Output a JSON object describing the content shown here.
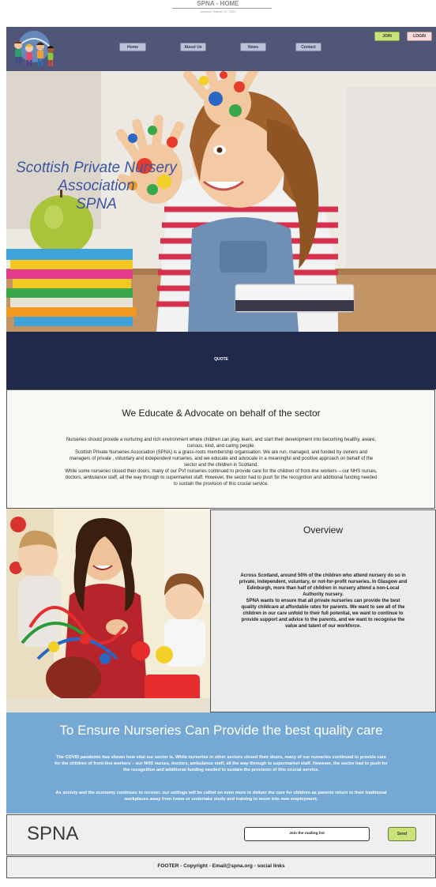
{
  "document": {
    "title": "SPNA - HOME",
    "meta": "seaimoi | March 17, 2022"
  },
  "header": {
    "nav": [
      "Home",
      "About Us",
      "News",
      "Contact"
    ],
    "join_label": "JOIN",
    "login_label": "LOGIN",
    "bg_color": "#4f5677"
  },
  "hero": {
    "title_lines": [
      "Scottish Private Nursery",
      "Association",
      "SPNA"
    ]
  },
  "quote": {
    "text": "QUOTE"
  },
  "educate": {
    "heading": "We Educate & Advocate on behalf of the sector",
    "paragraphs": [
      "Nurseries should provide a nurturing and rich environment where children can play, learn, and start their development into becoming healthy, aware, curious, kind, and caring people.",
      "Scottish Private Nurseries Association (SPNA) is a grass-roots membership organisation. We are run, managed, and funded by owners and managers of private , voluntary and independent nurseries, and we educate and advocate in a meaningful and positive approach on behalf of the sector and the children in Scotland.",
      "While some nurseries closed their doors, many of our PVI nurseries continued to provide care for the children of front-line workers – our NHS nurses, doctors, ambulance staff, all the way through to supermarket staff. However, the sector had to push for the recognition and additional funding needed to sustain the provision of this crucial service."
    ]
  },
  "overview": {
    "heading": "Overview",
    "paragraphs": [
      "Across Scotland, around 50% of the children who attend nursery do so in private, independent, voluntary, or not-for-profit nurseries. In Glasgow and Edinburgh, more than half of children in nursery attend a non-Local Authority nursery.",
      "SPNA wants to ensure that all private nurseries can provide the best quality childcare at affordable rates for parents. We want to see all of the children in our care unfold to their full potential, we want to continue to provide support and advice to the parents, and we want to recognise the value and talent of our workforce."
    ]
  },
  "quality": {
    "heading": "To Ensure Nurseries Can Provide the best quality care",
    "paragraphs": [
      "The COVID pandemic has shown how vital our sector is. While nurseries in other sectors closed their doors, many of our nurseries continued to provide care for the children of front-line workers – our NHS nurses, doctors, ambulance staff, all the way through to supermarket staff. However, the sector had to push for the recognition and additional funding needed to sustain the provision of this crucial service.",
      "As society and the economy continues to recover, our settings will be called on even more to deliver the care for children as parents return to their traditional workplaces away from home or undertake study and training to move into new employment."
    ],
    "bg_color": "#75a9d4"
  },
  "mailing": {
    "brand": "SPNA",
    "input_placeholder": "Join the mailing list",
    "send_label": "Send"
  },
  "footer": {
    "text": "FOOTER - Copyright - Email@spna.org - social links"
  }
}
